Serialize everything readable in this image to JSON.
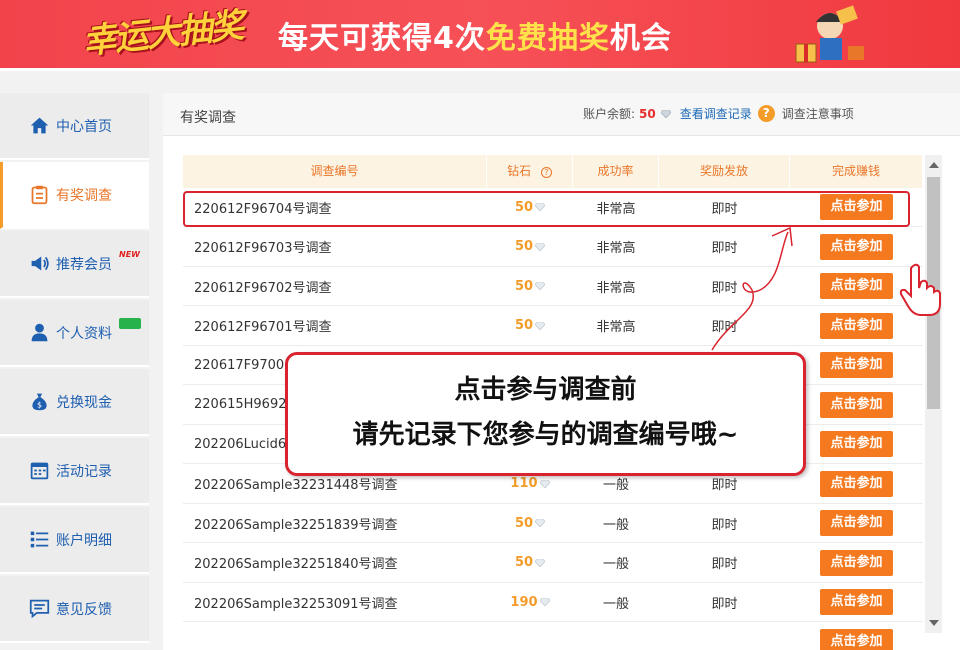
{
  "banner": {
    "logo_text": "幸运大抽奖",
    "text_pre": "每天可获得4次",
    "text_highlight": "免费抽奖",
    "text_post": "机会"
  },
  "sidebar": {
    "items": [
      {
        "label": "中心首页",
        "icon": "home-icon"
      },
      {
        "label": "有奖调查",
        "icon": "clipboard-icon",
        "active": true
      },
      {
        "label": "推荐会员",
        "icon": "megaphone-icon",
        "badge": "NEW"
      },
      {
        "label": "个人资料",
        "icon": "user-icon"
      },
      {
        "label": "兑换现金",
        "icon": "money-bag-icon"
      },
      {
        "label": "活动记录",
        "icon": "calendar-icon"
      },
      {
        "label": "账户明细",
        "icon": "list-icon"
      },
      {
        "label": "意见反馈",
        "icon": "feedback-icon"
      }
    ]
  },
  "header": {
    "title": "有奖调查",
    "balance_label": "账户余额:",
    "balance_value": "50",
    "records_link": "查看调查记录",
    "notes_link": "调查注意事项"
  },
  "table": {
    "columns": [
      "调查编号",
      "钻石",
      "成功率",
      "奖励发放",
      "完成赚钱"
    ],
    "rows": [
      {
        "id": "220612F96704号调查",
        "diamonds": "50",
        "rate": "非常高",
        "payout": "即时",
        "action": "点击参加"
      },
      {
        "id": "220612F96703号调查",
        "diamonds": "50",
        "rate": "非常高",
        "payout": "即时",
        "action": "点击参加"
      },
      {
        "id": "220612F96702号调查",
        "diamonds": "50",
        "rate": "非常高",
        "payout": "即时",
        "action": "点击参加"
      },
      {
        "id": "220612F96701号调查",
        "diamonds": "50",
        "rate": "非常高",
        "payout": "即时",
        "action": "点击参加"
      },
      {
        "id": "220617F97001",
        "diamonds": "",
        "rate": "",
        "payout": "",
        "action": "点击参加"
      },
      {
        "id": "220615H96926",
        "diamonds": "",
        "rate": "",
        "payout": "",
        "action": "点击参加"
      },
      {
        "id": "202206Lucid6",
        "diamonds": "",
        "rate": "",
        "payout": "",
        "action": "点击参加"
      },
      {
        "id": "202206Sample32231448号调查",
        "diamonds": "110",
        "rate": "一般",
        "payout": "即时",
        "action": "点击参加"
      },
      {
        "id": "202206Sample32251839号调查",
        "diamonds": "50",
        "rate": "一般",
        "payout": "即时",
        "action": "点击参加"
      },
      {
        "id": "202206Sample32251840号调查",
        "diamonds": "50",
        "rate": "一般",
        "payout": "即时",
        "action": "点击参加"
      },
      {
        "id": "202206Sample32253091号调查",
        "diamonds": "190",
        "rate": "一般",
        "payout": "即时",
        "action": "点击参加"
      },
      {
        "id": "",
        "diamonds": "",
        "rate": "",
        "payout": "",
        "action": "点击参加"
      }
    ]
  },
  "callout": {
    "line1": "点击参与调查前",
    "line2": "请先记录下您参与的调查编号哦~"
  },
  "colors": {
    "banner_red": "#f2434b",
    "accent_orange": "#f4791f",
    "link_blue": "#1e6ab6",
    "annotation_red": "#d9232e"
  }
}
